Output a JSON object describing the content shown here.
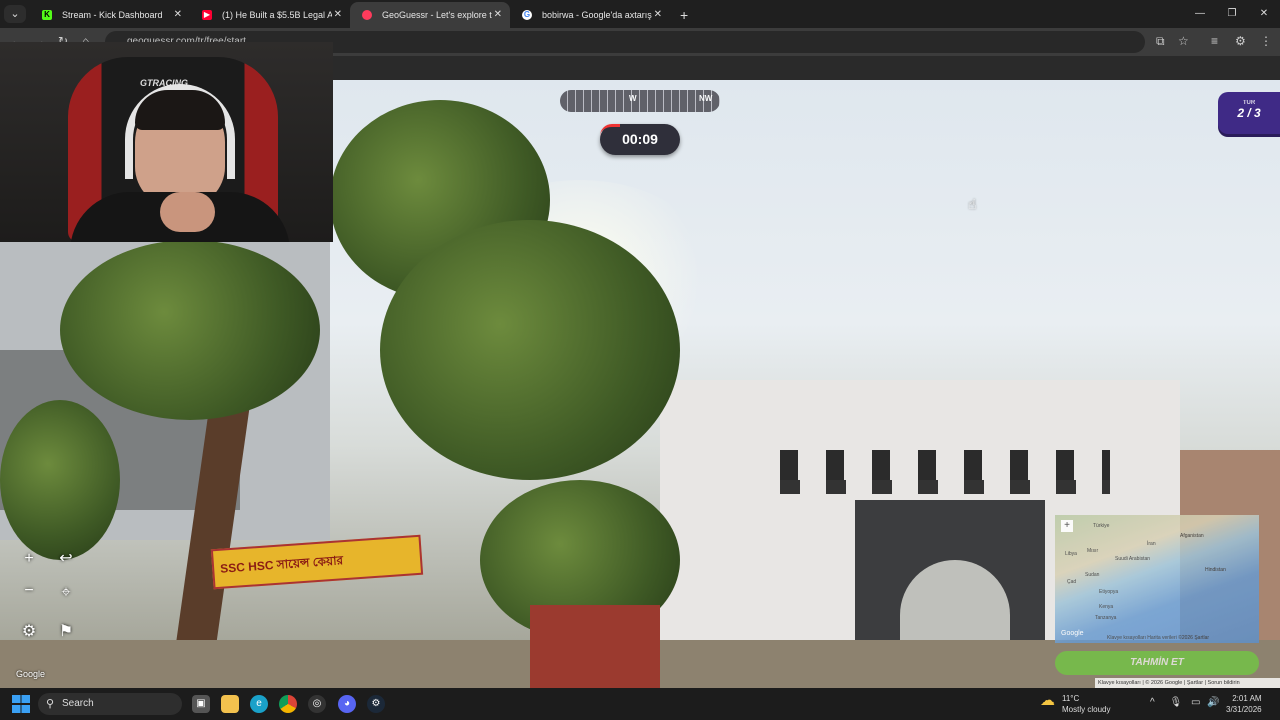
{
  "browser": {
    "tabs": [
      {
        "label": "Stream - Kick Dashboard",
        "favicon": "kick-icon",
        "color": "#53fc18"
      },
      {
        "label": "(1) He Built a $5.5B Legal AI Co",
        "favicon": "youtube-icon",
        "color": "#ff0033"
      },
      {
        "label": "GeoGuessr - Let's explore the w",
        "favicon": "geoguessr-icon",
        "color": "#ff3b5c"
      },
      {
        "label": "bobirwa - Google'da axtarış",
        "favicon": "google-icon",
        "color": "#ffffff"
      }
    ],
    "active_tab_index": 2,
    "url": "geoguessr.com/tr/free/start",
    "window_controls": [
      "—",
      "❐",
      "✕"
    ]
  },
  "game": {
    "compass": {
      "left_mark": "W",
      "right_mark": "NW"
    },
    "timer": "00:09",
    "round": {
      "label": "TUR",
      "value": "2 / 3"
    },
    "guess_button": "TAHMİN ET",
    "minimap_labels": [
      "Türkiye",
      "Afganistan",
      "İran",
      "Libya",
      "Mısır",
      "Suudi Arabistan",
      "Sudan",
      "Çad",
      "Etiyopya",
      "Kenya",
      "Tanzanya",
      "Hindistan",
      "Google"
    ],
    "minimap_footer": "Klavye kısayolları   Harita verileri ©2026   Şartlar",
    "footer": "Klavye kısayolları | © 2026 Google | Şartlar | Sorun bildirin",
    "google_logo": "Google",
    "banner_text": "SSC HSC সায়েন্স কেয়ার"
  },
  "webcam": {
    "chair_brand": "GTRACING"
  },
  "taskbar": {
    "search_placeholder": "Search",
    "weather": {
      "temp": "11°C",
      "condition": "Mostly cloudy"
    },
    "time": "2:01 AM",
    "date": "3/31/2026"
  },
  "colors": {
    "accent_purple": "#3f2a86",
    "guess_green": "#6fcf3e",
    "timer_bg": "#2f2f3a"
  }
}
